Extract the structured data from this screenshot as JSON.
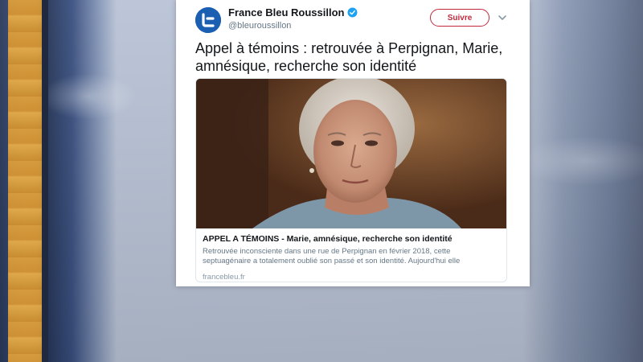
{
  "tweet": {
    "account_name": "France Bleu Roussillon",
    "handle": "@bleuroussillon",
    "follow_label": "Suivre",
    "text": "Appel à témoins : retrouvée à Perpignan, Marie, amnésique, recherche son identité",
    "card": {
      "title": "APPEL A TÉMOINS - Marie, amnésique, recherche son identité",
      "description": "Retrouvée inconsciente dans une rue de Perpignan en février 2018, cette septuagénaire a totalement oublié son passé et son identité. Aujourd'hui elle",
      "domain": "francebleu.fr"
    }
  },
  "icons": {
    "avatar": "france-bleu-logo",
    "verified": "verified-badge-icon",
    "menu": "chevron-down-icon"
  },
  "colors": {
    "follow_accent": "#c0293c",
    "verified_blue": "#1da1f2",
    "avatar_blue": "#1b5fb3"
  }
}
